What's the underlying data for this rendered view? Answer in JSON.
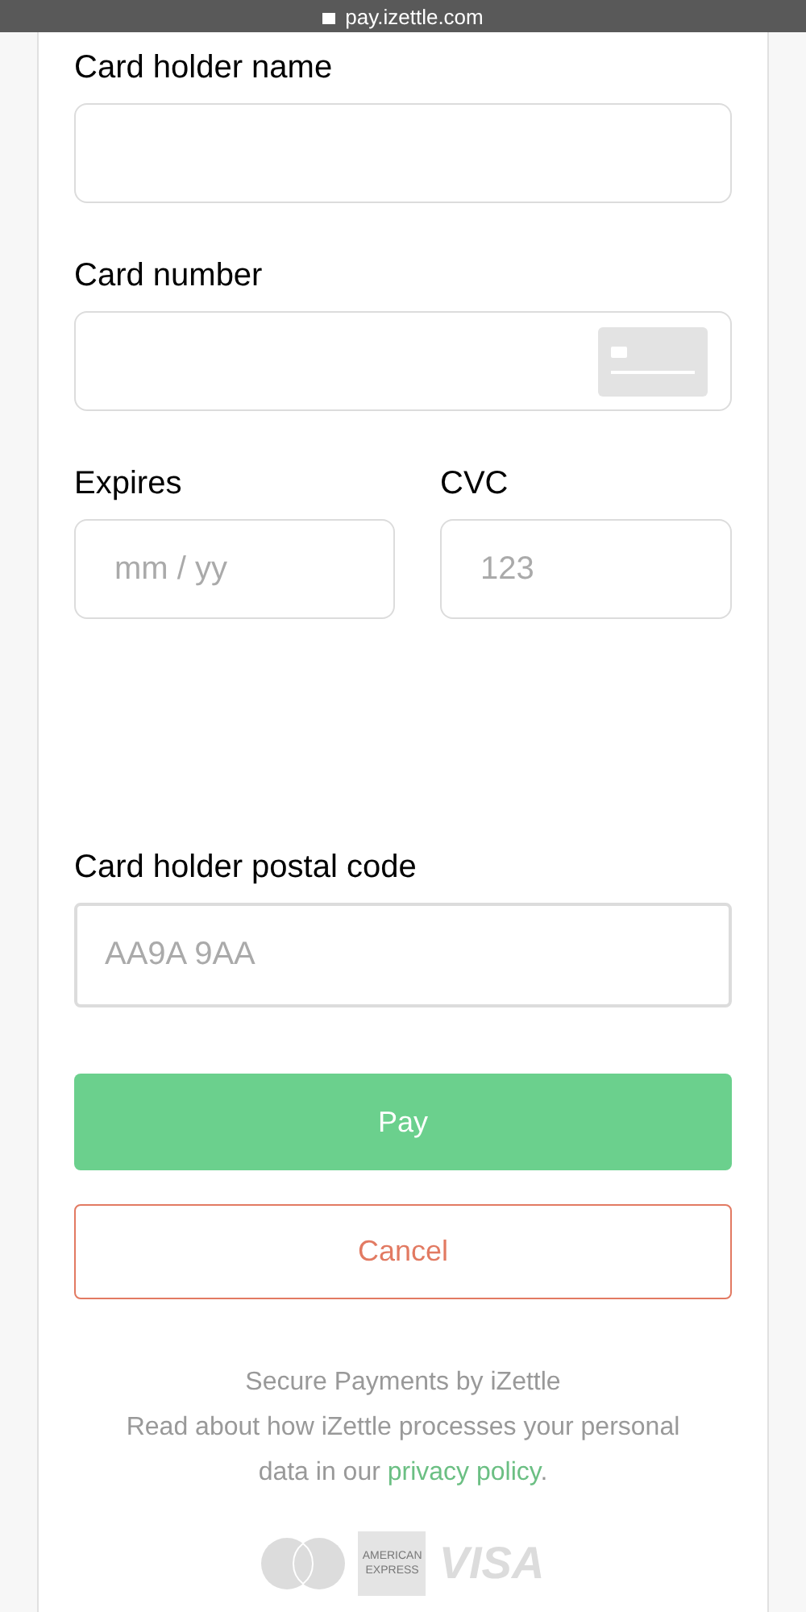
{
  "browser_bar": {
    "url": "pay.izettle.com"
  },
  "form": {
    "fields": [
      {
        "label": "Card holder name"
      },
      {
        "label": "Card number"
      }
    ],
    "row_fields": [
      {
        "label": "Expires",
        "placeholder": "mm / yy"
      },
      {
        "label": "CVC",
        "placeholder": "123"
      }
    ],
    "postal": {
      "label": "Card holder postal code",
      "placeholder": "AA9A 9AA"
    },
    "pay_button": "Pay",
    "cancel_button": "Cancel"
  },
  "footer": {
    "title": "Secure Payments by iZettle",
    "text": "Read about how iZettle processes your personal data in our",
    "link": "privacy policy",
    "end": "."
  },
  "payment_logos": {
    "amex": "AMERICAN EXPRESS",
    "visa": "VISA"
  }
}
